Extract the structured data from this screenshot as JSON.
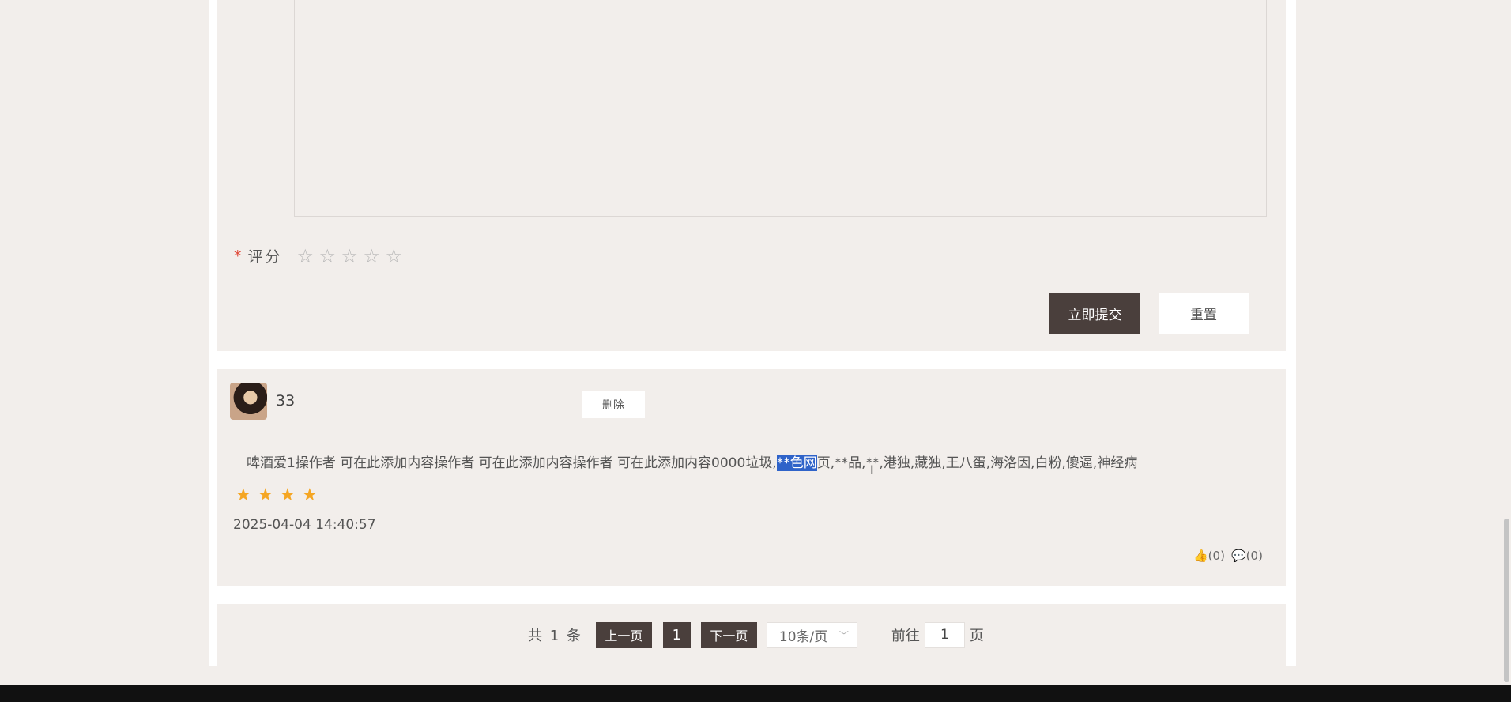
{
  "rating_form": {
    "required_mark": "*",
    "rating_label": "评分",
    "rating_value": 0,
    "stars": [
      "☆",
      "☆",
      "☆",
      "☆",
      "☆"
    ],
    "submit_label": "立即提交",
    "reset_label": "重置"
  },
  "comment": {
    "username": "33",
    "delete_label": "删除",
    "text_before": "啤酒爱1操作者 可在此添加内容操作者 可在此添加内容操作者 可在此添加内容0000垃圾,",
    "text_selected": "**色网",
    "text_after": "页,**品,**,港独,藏独,王八蛋,海洛因,白粉,傻逼,神经病",
    "rating": 4,
    "stars": [
      "★",
      "★",
      "★",
      "★",
      "★"
    ],
    "timestamp": "2025-04-04 14:40:57",
    "likes": "👍(0)",
    "replies": "💬(0)"
  },
  "pagination": {
    "total": "共 1 条",
    "prev_label": "上一页",
    "current_page": "1",
    "next_label": "下一页",
    "page_size": "10条/页",
    "goto_prefix": "前往",
    "goto_value": "1",
    "goto_suffix": "页"
  },
  "colors": {
    "accent_dark": "#4a3f3c",
    "star_filled": "#f5a623",
    "selection": "#2f63c9",
    "required": "#e04a3a"
  }
}
